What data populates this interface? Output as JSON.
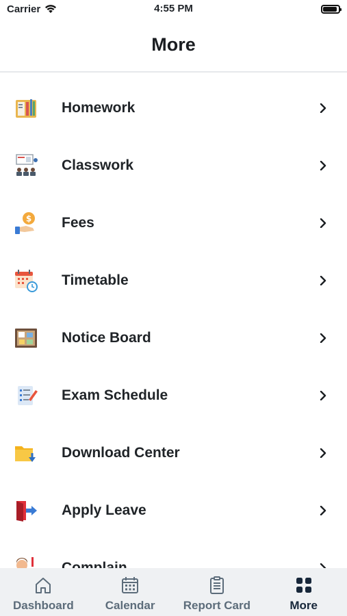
{
  "status_bar": {
    "carrier": "Carrier",
    "time": "4:55 PM"
  },
  "header": {
    "title": "More"
  },
  "menu": [
    {
      "label": "Homework",
      "icon": "homework-icon"
    },
    {
      "label": "Classwork",
      "icon": "classwork-icon"
    },
    {
      "label": "Fees",
      "icon": "fees-icon"
    },
    {
      "label": "Timetable",
      "icon": "timetable-icon"
    },
    {
      "label": "Notice Board",
      "icon": "notice-board-icon"
    },
    {
      "label": "Exam Schedule",
      "icon": "exam-schedule-icon"
    },
    {
      "label": "Download Center",
      "icon": "download-center-icon"
    },
    {
      "label": "Apply Leave",
      "icon": "apply-leave-icon"
    },
    {
      "label": "Complain",
      "icon": "complain-icon"
    }
  ],
  "tabs": [
    {
      "label": "Dashboard",
      "icon": "home-icon",
      "active": false
    },
    {
      "label": "Calendar",
      "icon": "calendar-icon",
      "active": false
    },
    {
      "label": "Report Card",
      "icon": "report-card-icon",
      "active": false
    },
    {
      "label": "More",
      "icon": "grid-icon",
      "active": true
    }
  ],
  "colors": {
    "tabbar_bg": "#eff1f3",
    "active_tab": "#17273a",
    "inactive_tab": "#5c6c7a"
  }
}
